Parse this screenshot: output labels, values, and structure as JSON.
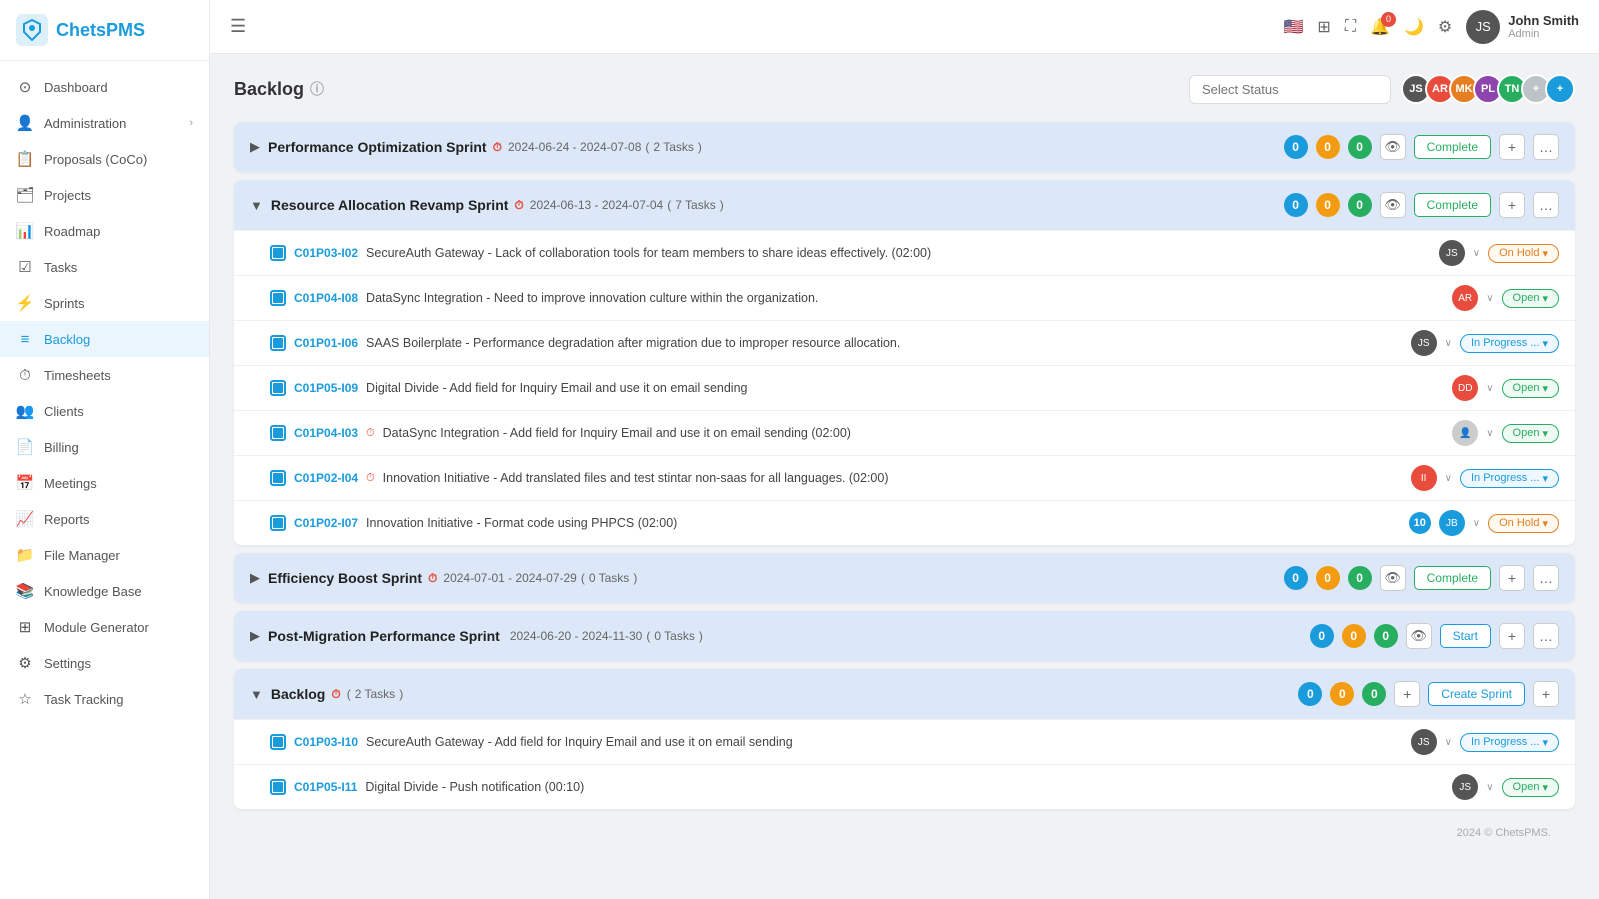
{
  "app": {
    "logo_text": "ChetsPMS",
    "footer": "2024 © ChetsPMS."
  },
  "header": {
    "hamburger": "☰",
    "user_name": "John Smith",
    "user_role": "Admin",
    "notif_count": "0"
  },
  "sidebar": {
    "items": [
      {
        "id": "dashboard",
        "label": "Dashboard",
        "icon": "⊙"
      },
      {
        "id": "administration",
        "label": "Administration",
        "icon": "👤",
        "arrow": "›"
      },
      {
        "id": "proposals",
        "label": "Proposals (CoCo)",
        "icon": "📋"
      },
      {
        "id": "projects",
        "label": "Projects",
        "icon": "🗂"
      },
      {
        "id": "roadmap",
        "label": "Roadmap",
        "icon": "📊"
      },
      {
        "id": "tasks",
        "label": "Tasks",
        "icon": "☑"
      },
      {
        "id": "sprints",
        "label": "Sprints",
        "icon": "⚡"
      },
      {
        "id": "backlog",
        "label": "Backlog",
        "icon": "≡",
        "active": true
      },
      {
        "id": "timesheets",
        "label": "Timesheets",
        "icon": "⏱"
      },
      {
        "id": "clients",
        "label": "Clients",
        "icon": "👥"
      },
      {
        "id": "billing",
        "label": "Billing",
        "icon": "📄"
      },
      {
        "id": "meetings",
        "label": "Meetings",
        "icon": "📅"
      },
      {
        "id": "reports",
        "label": "Reports",
        "icon": "📈"
      },
      {
        "id": "file-manager",
        "label": "File Manager",
        "icon": "📁"
      },
      {
        "id": "knowledge-base",
        "label": "Knowledge Base",
        "icon": "📚"
      },
      {
        "id": "module-generator",
        "label": "Module Generator",
        "icon": "⊞"
      },
      {
        "id": "settings",
        "label": "Settings",
        "icon": "⚙"
      },
      {
        "id": "task-tracking",
        "label": "Task Tracking",
        "icon": "☆"
      }
    ]
  },
  "backlog": {
    "title": "Backlog",
    "select_status_placeholder": "Select Status",
    "add_button": "+",
    "sprints": [
      {
        "id": "sprint1",
        "name": "Performance Optimization Sprint",
        "dates": "2024-06-24 - 2024-07-08",
        "task_count": "2 Tasks",
        "counts": [
          0,
          0,
          0
        ],
        "status_btn": "Complete",
        "collapsed": true,
        "tasks": []
      },
      {
        "id": "sprint2",
        "name": "Resource Allocation Revamp Sprint",
        "dates": "2024-06-13 - 2024-07-04",
        "task_count": "7 Tasks",
        "counts": [
          0,
          0,
          0
        ],
        "status_btn": "Complete",
        "collapsed": false,
        "tasks": [
          {
            "id": "C01P03-I02",
            "desc": "SecureAuth Gateway - Lack of collaboration tools for team members to share ideas effectively. (02:00)",
            "status": "On Hold",
            "status_class": "sb-onhold",
            "avatar": "av-dark",
            "has_flag": false
          },
          {
            "id": "C01P04-I08",
            "desc": "DataSync Integration - Need to improve innovation culture within the organization.",
            "status": "Open",
            "status_class": "sb-open",
            "avatar": "av-red",
            "has_flag": false
          },
          {
            "id": "C01P01-I06",
            "desc": "SAAS Boilerplate - Performance degradation after migration due to improper resource allocation.",
            "status": "In Progress ...",
            "status_class": "sb-inprogress",
            "avatar": "av-dark",
            "has_flag": false
          },
          {
            "id": "C01P05-I09",
            "desc": "Digital Divide - Add field for Inquiry Email and use it on email sending",
            "status": "Open",
            "status_class": "sb-open",
            "avatar": "av-red",
            "has_flag": false
          },
          {
            "id": "C01P04-I03",
            "desc": "DataSync Integration - Add field for Inquiry Email and use it on email sending (02:00)",
            "status": "Open",
            "status_class": "sb-open",
            "avatar": "person",
            "has_flag": true
          },
          {
            "id": "C01P02-I04",
            "desc": "Innovation Initiative - Add translated files and test stintar non-saas for all languages. (02:00)",
            "status": "In Progress ...",
            "status_class": "sb-inprogress",
            "avatar": "av-red",
            "has_flag": true
          },
          {
            "id": "C01P02-I07",
            "desc": "Innovation Initiative - Format code using PHPCS (02:00)",
            "status": "On Hold",
            "status_class": "sb-onhold",
            "avatar": "av-blue",
            "has_flag": false,
            "badge_num": "10"
          }
        ]
      },
      {
        "id": "sprint3",
        "name": "Efficiency Boost Sprint",
        "dates": "2024-07-01 - 2024-07-29",
        "task_count": "0 Tasks",
        "counts": [
          0,
          0,
          0
        ],
        "status_btn": "Complete",
        "collapsed": true,
        "tasks": []
      },
      {
        "id": "sprint4",
        "name": "Post-Migration Performance Sprint",
        "dates": "2024-06-20 - 2024-11-30",
        "task_count": "0 Tasks",
        "counts": [
          0,
          0,
          0
        ],
        "status_btn": "Start",
        "collapsed": true,
        "tasks": []
      },
      {
        "id": "backlog-section",
        "name": "Backlog",
        "dates": "",
        "task_count": "2 Tasks",
        "counts": [
          0,
          0,
          0
        ],
        "status_btn": "Create Sprint",
        "is_backlog": true,
        "collapsed": false,
        "tasks": [
          {
            "id": "C01P03-I10",
            "desc": "SecureAuth Gateway - Add field for Inquiry Email and use it on email sending",
            "status": "In Progress ...",
            "status_class": "sb-inprogress",
            "avatar": "av-dark",
            "has_flag": false
          },
          {
            "id": "C01P05-I11",
            "desc": "Digital Divide - Push notification (00:10)",
            "status": "Open",
            "status_class": "sb-open",
            "avatar": "av-dark",
            "has_flag": false
          }
        ]
      }
    ]
  }
}
